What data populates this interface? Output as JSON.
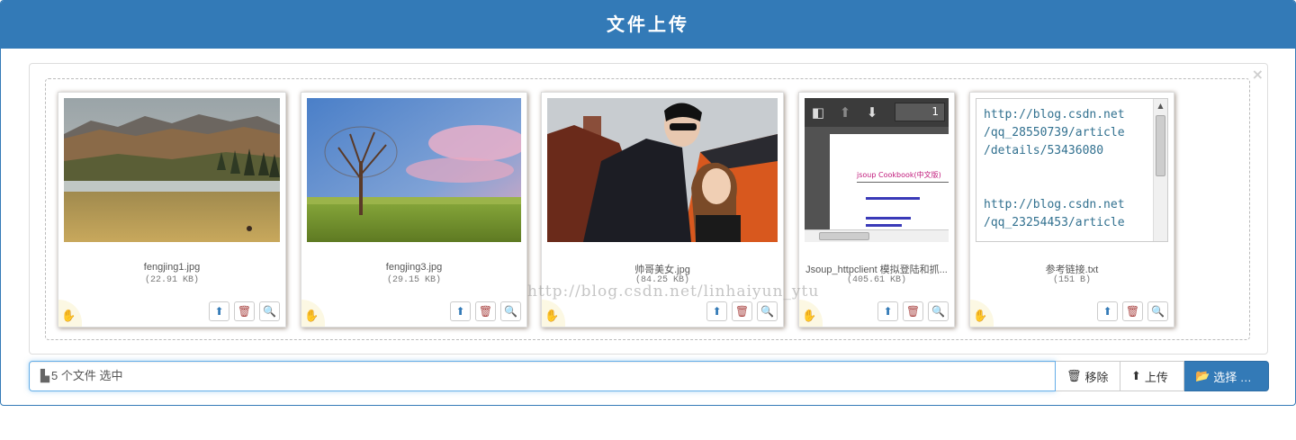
{
  "panel": {
    "title": "文件上传"
  },
  "preview": {
    "close_glyph": "×",
    "watermark": "http://blog.csdn.net/linhaiyun_ytu",
    "files": [
      {
        "name": "fengjing1.jpg",
        "size": "(22.91 KB)",
        "type": "image",
        "subject": "mountain landscape"
      },
      {
        "name": "fengjing3.jpg",
        "size": "(29.15 KB)",
        "type": "image",
        "subject": "tree on grassland"
      },
      {
        "name": "帅哥美女.jpg",
        "size": "(84.25 KB)",
        "type": "image",
        "subject": "couple with car"
      },
      {
        "name": "Jsoup_httpclient 模拟登陆和抓...",
        "size": "(405.61 KB)",
        "type": "pdf",
        "page_number": "1",
        "doc_title": "jsoup Cookbook(中文版)"
      },
      {
        "name": "参考链接.txt",
        "size": "(151 B)",
        "type": "text",
        "text_content": "http://blog.csdn.net\n/qq_28550739/article\n/details/53436080\n\n\nhttp://blog.csdn.net\n/qq_23254453/article"
      }
    ]
  },
  "footer": {
    "caption": "5 个文件 选中",
    "remove_label": "移除",
    "upload_label": "上传",
    "browse_label": "选择 …"
  },
  "colors": {
    "primary": "#337ab7",
    "danger": "#a94442",
    "drag_bg": "#fcf8e3"
  }
}
